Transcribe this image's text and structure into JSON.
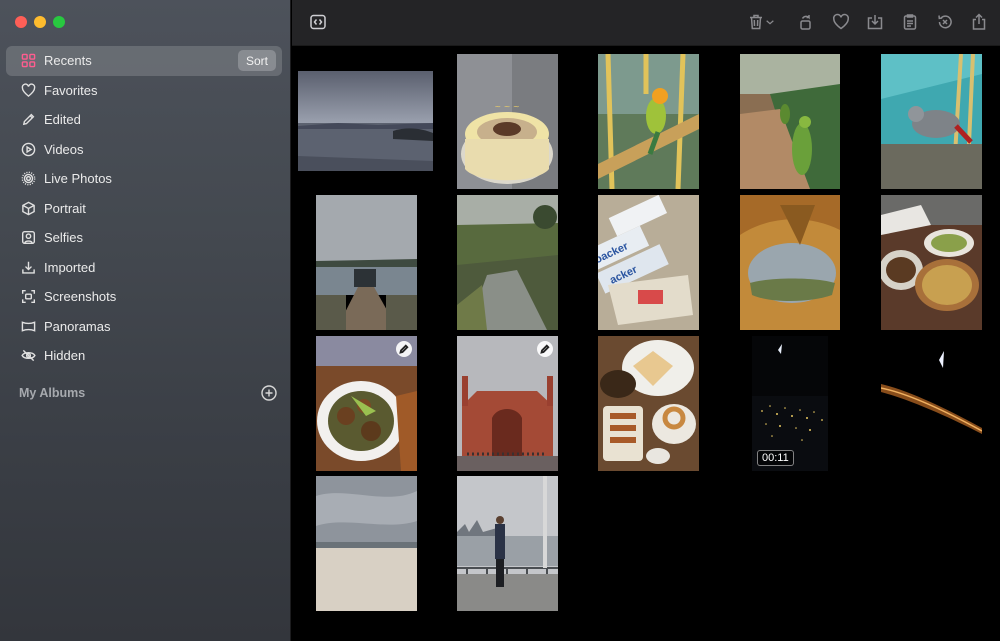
{
  "sidebar": {
    "items": [
      {
        "label": "Recents"
      },
      {
        "label": "Favorites"
      },
      {
        "label": "Edited"
      },
      {
        "label": "Videos"
      },
      {
        "label": "Live Photos"
      },
      {
        "label": "Portrait"
      },
      {
        "label": "Selfies"
      },
      {
        "label": "Imported"
      },
      {
        "label": "Screenshots"
      },
      {
        "label": "Panoramas"
      },
      {
        "label": "Hidden"
      }
    ],
    "sort_label": "Sort",
    "albums_label": "My Albums"
  },
  "toolbar": {
    "icons": [
      "sidebar-toggle-icon",
      "trash-icon",
      "rotate-icon",
      "heart-icon",
      "export-icon",
      "info-icon",
      "revert-icon",
      "share-icon"
    ]
  },
  "grid": {
    "video_duration": "00:11"
  },
  "colors": {
    "accent": "#ff5d8f",
    "toolbar_bg": "#242426",
    "grid_bg": "#000000"
  }
}
